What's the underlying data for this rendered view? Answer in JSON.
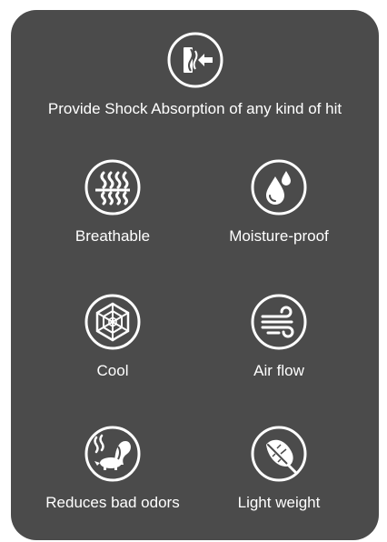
{
  "features": [
    {
      "id": "shock",
      "label": "Provide Shock Absorption of any kind of hit",
      "icon": "shock-absorption-icon"
    },
    {
      "id": "breathable",
      "label": "Breathable",
      "icon": "breathable-icon"
    },
    {
      "id": "moisture",
      "label": "Moisture-proof",
      "icon": "moisture-proof-icon"
    },
    {
      "id": "cool",
      "label": "Cool",
      "icon": "cool-snowflake-icon"
    },
    {
      "id": "airflow",
      "label": "Air flow",
      "icon": "air-flow-icon"
    },
    {
      "id": "odors",
      "label": "Reduces bad odors",
      "icon": "skunk-icon"
    },
    {
      "id": "light",
      "label": "Light weight",
      "icon": "feather-icon"
    }
  ],
  "colors": {
    "card_background": "#4b4b4b",
    "page_background": "#ffffff",
    "foreground": "#ffffff"
  }
}
